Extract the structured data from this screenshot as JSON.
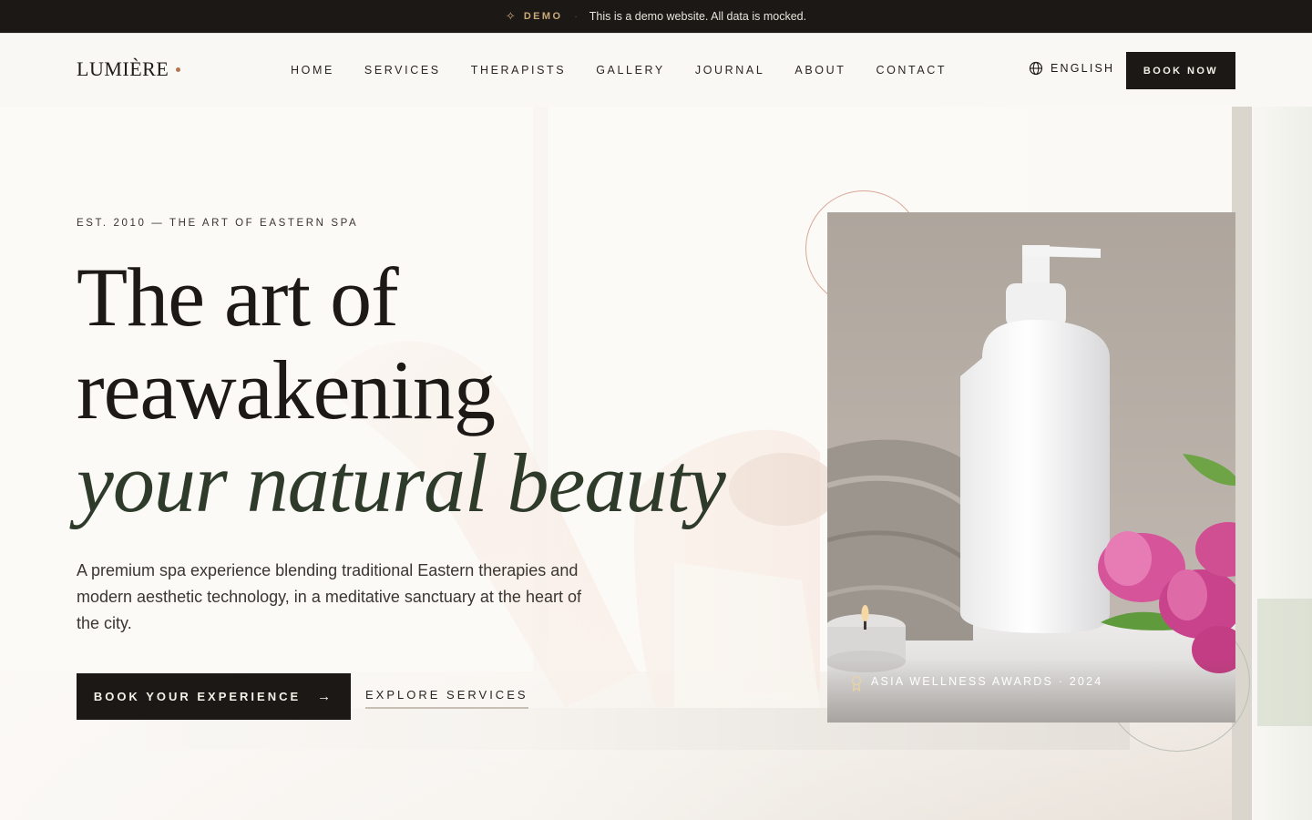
{
  "demo_banner": {
    "label": "DEMO",
    "separator": "·",
    "text": "This is a demo website. All data is mocked."
  },
  "header": {
    "logo": "LUMIÈRE",
    "nav": [
      "HOME",
      "SERVICES",
      "THERAPISTS",
      "GALLERY",
      "JOURNAL",
      "ABOUT",
      "CONTACT"
    ],
    "language": "ENGLISH",
    "book_now": "BOOK NOW"
  },
  "hero": {
    "eyebrow": "EST. 2010 — THE ART OF EASTERN SPA",
    "headline_line1": "The art of",
    "headline_line2": "reawakening",
    "headline_line3": "your natural beauty",
    "lead": "A premium spa experience blending traditional Eastern therapies and modern aesthetic technology, in a meditative sanctuary at the heart of the city.",
    "cta_primary": "BOOK YOUR EXPERIENCE",
    "cta_secondary": "EXPLORE SERVICES",
    "award": "ASIA WELLNESS AWARDS · 2024"
  },
  "icons": {
    "demo": "sparkle-icon",
    "language": "globe-icon",
    "cta": "arrow-right-icon",
    "award": "award-ribbon-icon"
  },
  "colors": {
    "dark": "#1c1815",
    "accent": "#b5764e",
    "gold": "#c9a977",
    "background": "#fbf9f5",
    "headline_italic": "#2e3a2a"
  }
}
